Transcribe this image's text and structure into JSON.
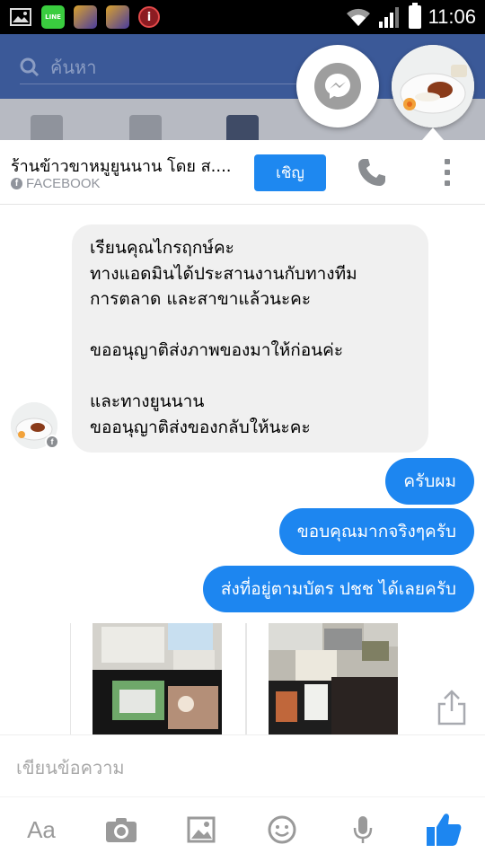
{
  "status_bar": {
    "time": "11:06",
    "icons": [
      "gallery-icon",
      "line-icon",
      "game-icon",
      "game-icon",
      "info-icon",
      "wifi-icon",
      "signal-icon",
      "battery-icon"
    ]
  },
  "background_app": {
    "search_placeholder": "ค้นหา",
    "header_color": "#3b5998"
  },
  "chat": {
    "title": "ร้านข้าวขาหมูยูนนาน โดย ส....",
    "subtitle": "FACEBOOK",
    "invite_label": "เชิญ",
    "incoming_message": [
      "เรียนคุณไกรฤกษ์คะ",
      "ทางแอดมินได้ประสานงานกับทางทีม",
      "การตลาด และสาขาแล้วนะคะ",
      "",
      "ขออนุญาติส่งภาพของมาให้ก่อนค่ะ",
      "",
      "และทางยูนนาน",
      "ขออนุญาติส่งของกลับให้นะคะ"
    ],
    "outgoing_messages": [
      "ครับผม",
      "ขอบคุณมากจริงๆครับ",
      "ส่งที่อยู่ตามบัตร ปชช ได้เลยครับ"
    ],
    "accent_color": "#1d86f0"
  },
  "composer": {
    "placeholder": "เขียนข้อความ",
    "aa_label": "Aa",
    "tools": [
      "text-format-icon",
      "camera-icon",
      "gallery-icon",
      "emoji-icon",
      "microphone-icon",
      "like-icon"
    ]
  }
}
